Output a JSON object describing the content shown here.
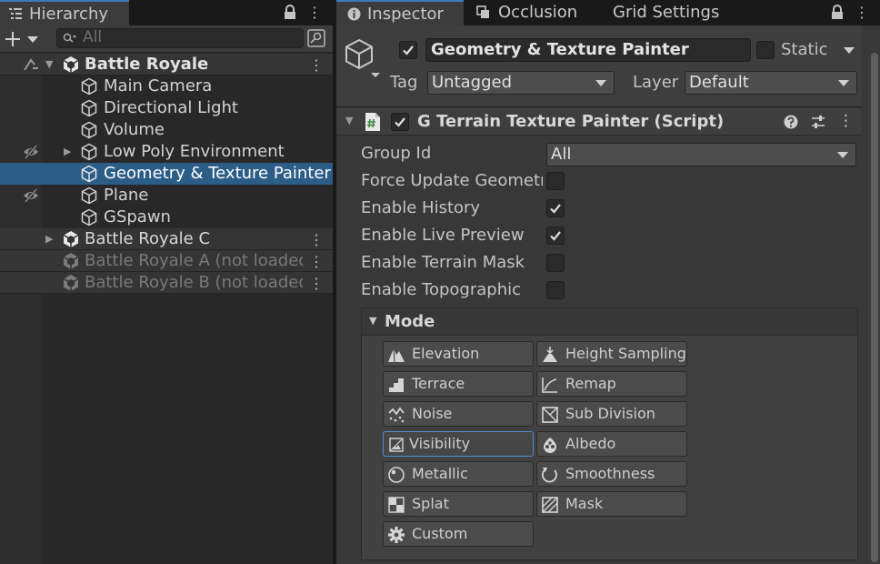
{
  "hierarchy": {
    "tab_label": "Hierarchy",
    "search_placeholder": "All",
    "rows": [
      {
        "label": "Battle Royale",
        "kind": "scene"
      },
      {
        "label": "Main Camera",
        "kind": "object"
      },
      {
        "label": "Directional Light",
        "kind": "object"
      },
      {
        "label": "Volume",
        "kind": "object"
      },
      {
        "label": "Low Poly Environment",
        "kind": "object"
      },
      {
        "label": "Geometry & Texture Painter",
        "kind": "object-selected"
      },
      {
        "label": "Plane",
        "kind": "object"
      },
      {
        "label": "GSpawn",
        "kind": "object"
      },
      {
        "label": "Battle Royale C",
        "kind": "scene"
      },
      {
        "label": "Battle Royale A (not loaded)",
        "kind": "scene-unloaded"
      },
      {
        "label": "Battle Royale B (not loaded)",
        "kind": "scene-unloaded"
      }
    ]
  },
  "inspector": {
    "tabs": [
      {
        "label": "Inspector"
      },
      {
        "label": "Occlusion"
      },
      {
        "label": "Grid Settings"
      }
    ],
    "object_name": "Geometry & Texture Painter",
    "static_label": "Static",
    "tag_label": "Tag",
    "tag_value": "Untagged",
    "layer_label": "Layer",
    "layer_value": "Default",
    "component_title": "G Terrain Texture Painter (Script)",
    "properties": [
      {
        "label": "Group Id",
        "type": "dropdown",
        "value": "All"
      },
      {
        "label": "Force Update Geometr",
        "type": "checkbox",
        "checked": false
      },
      {
        "label": "Enable History",
        "type": "checkbox",
        "checked": true
      },
      {
        "label": "Enable Live Preview",
        "type": "checkbox",
        "checked": true
      },
      {
        "label": "Enable Terrain Mask",
        "type": "checkbox",
        "checked": false
      },
      {
        "label": "Enable Topographic",
        "type": "checkbox",
        "checked": false
      }
    ],
    "mode_title": "Mode",
    "modes": [
      {
        "label": "Elevation",
        "icon": "elevation-icon"
      },
      {
        "label": "Height Sampling",
        "icon": "height-sampling-icon"
      },
      {
        "label": "Terrace",
        "icon": "terrace-icon"
      },
      {
        "label": "Remap",
        "icon": "remap-icon"
      },
      {
        "label": "Noise",
        "icon": "noise-icon"
      },
      {
        "label": "Sub Division",
        "icon": "sub-division-icon"
      },
      {
        "label": "Visibility",
        "icon": "visibility-icon",
        "active": true
      },
      {
        "label": "Albedo",
        "icon": "albedo-icon"
      },
      {
        "label": "Metallic",
        "icon": "metallic-icon"
      },
      {
        "label": "Smoothness",
        "icon": "smoothness-icon"
      },
      {
        "label": "Splat",
        "icon": "splat-icon"
      },
      {
        "label": "Mask",
        "icon": "mask-icon"
      },
      {
        "label": "Custom",
        "icon": "gear-icon"
      }
    ]
  },
  "colors": {
    "selection": "#2c5d87",
    "accent": "#3a79bb",
    "panel_bg": "#383838"
  }
}
